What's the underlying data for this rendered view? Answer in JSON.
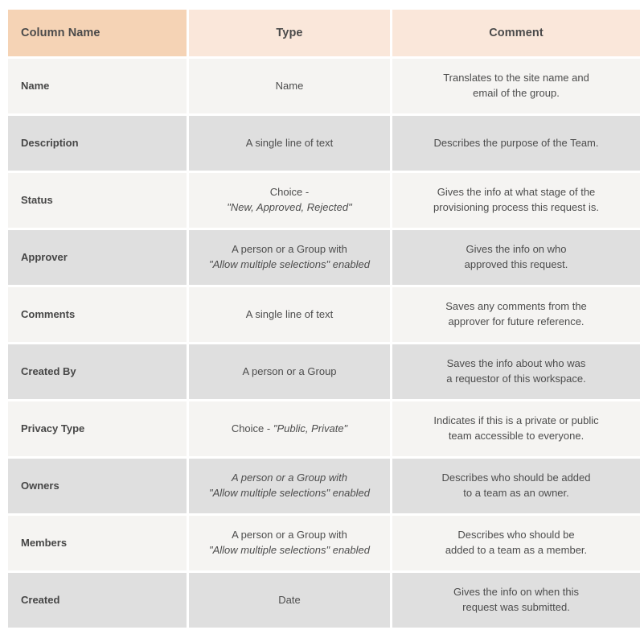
{
  "table": {
    "headers": [
      {
        "label": "Column Name",
        "align": "left",
        "bg": "#f5d3b5"
      },
      {
        "label": "Type",
        "align": "center",
        "bg": "#fae7da"
      },
      {
        "label": "Comment",
        "align": "center",
        "bg": "#fae7da"
      }
    ],
    "row_colors": {
      "light": "#f5f4f2",
      "dark": "#dfdfdf"
    },
    "rows": [
      {
        "name": "Name",
        "type_lines": [
          {
            "text": "Name",
            "italic": false
          }
        ],
        "comment_lines": [
          {
            "text": "Translates to the site name and",
            "italic": false
          },
          {
            "text": "email of the group.",
            "italic": false
          }
        ]
      },
      {
        "name": "Description",
        "type_lines": [
          {
            "text": "A single line of text",
            "italic": false
          }
        ],
        "comment_lines": [
          {
            "text": "Describes the purpose of the Team.",
            "italic": false
          }
        ]
      },
      {
        "name": "Status",
        "type_lines": [
          {
            "text": "Choice -",
            "italic": false
          },
          {
            "text": "\"New, Approved, Rejected\"",
            "italic": true
          }
        ],
        "comment_lines": [
          {
            "text": "Gives the info at what stage of the",
            "italic": false
          },
          {
            "text": "provisioning process this request is.",
            "italic": false
          }
        ]
      },
      {
        "name": "Approver",
        "type_lines": [
          {
            "text": "A person or a Group with",
            "italic": false
          },
          {
            "text": "\"Allow multiple selections\" enabled",
            "italic": true
          }
        ],
        "comment_lines": [
          {
            "text": "Gives the info on who",
            "italic": false
          },
          {
            "text": "approved this request.",
            "italic": false
          }
        ]
      },
      {
        "name": "Comments",
        "type_lines": [
          {
            "text": "A single line of text",
            "italic": false
          }
        ],
        "comment_lines": [
          {
            "text": "Saves any comments from the",
            "italic": false
          },
          {
            "text": "approver for future reference.",
            "italic": false
          }
        ]
      },
      {
        "name": "Created By",
        "type_lines": [
          {
            "text": "A person or a Group",
            "italic": false
          }
        ],
        "comment_lines": [
          {
            "text": "Saves the info about who was",
            "italic": false
          },
          {
            "text": "a requestor of this workspace.",
            "italic": false
          }
        ]
      },
      {
        "name": "Privacy Type",
        "type_lines": [
          {
            "text": "Choice - ",
            "italic": false,
            "inline": true
          },
          {
            "text": "\"Public, Private\"",
            "italic": true,
            "inline": true
          }
        ],
        "comment_lines": [
          {
            "text": "Indicates if this is a private or public",
            "italic": false
          },
          {
            "text": "team accessible to everyone.",
            "italic": false
          }
        ]
      },
      {
        "name": "Owners",
        "type_lines": [
          {
            "text": "A person or a Group with",
            "italic": true
          },
          {
            "text": "\"Allow multiple selections\" enabled",
            "italic": true
          }
        ],
        "comment_lines": [
          {
            "text": "Describes who should be added",
            "italic": false
          },
          {
            "text": "to a team as an owner.",
            "italic": false
          }
        ]
      },
      {
        "name": "Members",
        "type_lines": [
          {
            "text": "A person or a Group with",
            "italic": false
          },
          {
            "text": "\"Allow multiple selections\" enabled",
            "italic": true
          }
        ],
        "comment_lines": [
          {
            "text": "Describes who should be",
            "italic": false
          },
          {
            "text": "added to a team as a member.",
            "italic": false
          }
        ]
      },
      {
        "name": "Created",
        "type_lines": [
          {
            "text": "Date",
            "italic": false
          }
        ],
        "comment_lines": [
          {
            "text": "Gives the info on when this",
            "italic": false
          },
          {
            "text": "request was submitted.",
            "italic": false
          }
        ]
      }
    ]
  }
}
